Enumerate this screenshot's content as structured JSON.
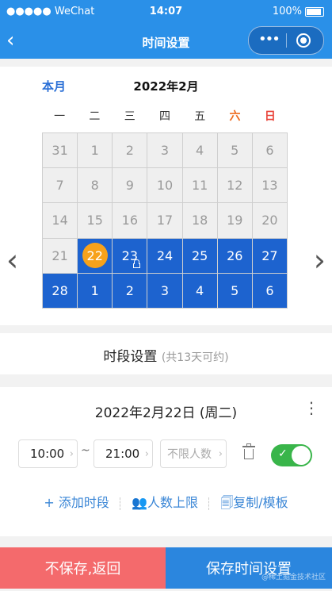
{
  "status_bar": {
    "carrier": "●●●●● WeChat",
    "time": "14:07",
    "battery": "100%"
  },
  "nav": {
    "back_icon": "‹",
    "title": "时间设置",
    "menu_icon": "•••"
  },
  "calendar": {
    "month_label": "本月",
    "title": "2022年2月",
    "weekdays": [
      "一",
      "二",
      "三",
      "四",
      "五",
      "六",
      "日"
    ],
    "cells": [
      {
        "d": "31",
        "s": "past"
      },
      {
        "d": "1",
        "s": "past"
      },
      {
        "d": "2",
        "s": "past"
      },
      {
        "d": "3",
        "s": "past"
      },
      {
        "d": "4",
        "s": "past"
      },
      {
        "d": "5",
        "s": "past"
      },
      {
        "d": "6",
        "s": "past"
      },
      {
        "d": "7",
        "s": "past"
      },
      {
        "d": "8",
        "s": "past"
      },
      {
        "d": "9",
        "s": "past"
      },
      {
        "d": "10",
        "s": "past"
      },
      {
        "d": "11",
        "s": "past"
      },
      {
        "d": "12",
        "s": "past"
      },
      {
        "d": "13",
        "s": "past"
      },
      {
        "d": "14",
        "s": "past"
      },
      {
        "d": "15",
        "s": "past"
      },
      {
        "d": "16",
        "s": "past"
      },
      {
        "d": "17",
        "s": "past"
      },
      {
        "d": "18",
        "s": "past"
      },
      {
        "d": "19",
        "s": "past"
      },
      {
        "d": "20",
        "s": "past"
      },
      {
        "d": "21",
        "s": "past"
      },
      {
        "d": "22",
        "s": "today"
      },
      {
        "d": "23",
        "s": "locked"
      },
      {
        "d": "24",
        "s": "avail"
      },
      {
        "d": "25",
        "s": "avail"
      },
      {
        "d": "26",
        "s": "avail"
      },
      {
        "d": "27",
        "s": "avail"
      },
      {
        "d": "28",
        "s": "avail"
      },
      {
        "d": "1",
        "s": "avail"
      },
      {
        "d": "2",
        "s": "avail"
      },
      {
        "d": "3",
        "s": "avail"
      },
      {
        "d": "4",
        "s": "avail"
      },
      {
        "d": "5",
        "s": "avail"
      },
      {
        "d": "6",
        "s": "avail"
      }
    ],
    "prev_icon": "‹",
    "next_icon": "›"
  },
  "period": {
    "title": "时段设置",
    "note": "(共13天可约)"
  },
  "slot": {
    "date": "2022年2月22日 (周二)",
    "start_time": "10:00",
    "separator": "~",
    "end_time": "21:00",
    "limit_placeholder": "不限人数",
    "enabled": true,
    "actions": {
      "add": "+ 添加时段",
      "limit": "人数上限",
      "copy": "复制/模板"
    }
  },
  "buttons": {
    "back": "不保存,返回",
    "save": "保存时间设置"
  },
  "watermark": "@稀土掘金技术社区",
  "colors": {
    "primary": "#2a90e8",
    "available": "#1d63cf",
    "today": "#f7a21b",
    "danger": "#f46a6c",
    "toggle_on": "#39b54a"
  }
}
